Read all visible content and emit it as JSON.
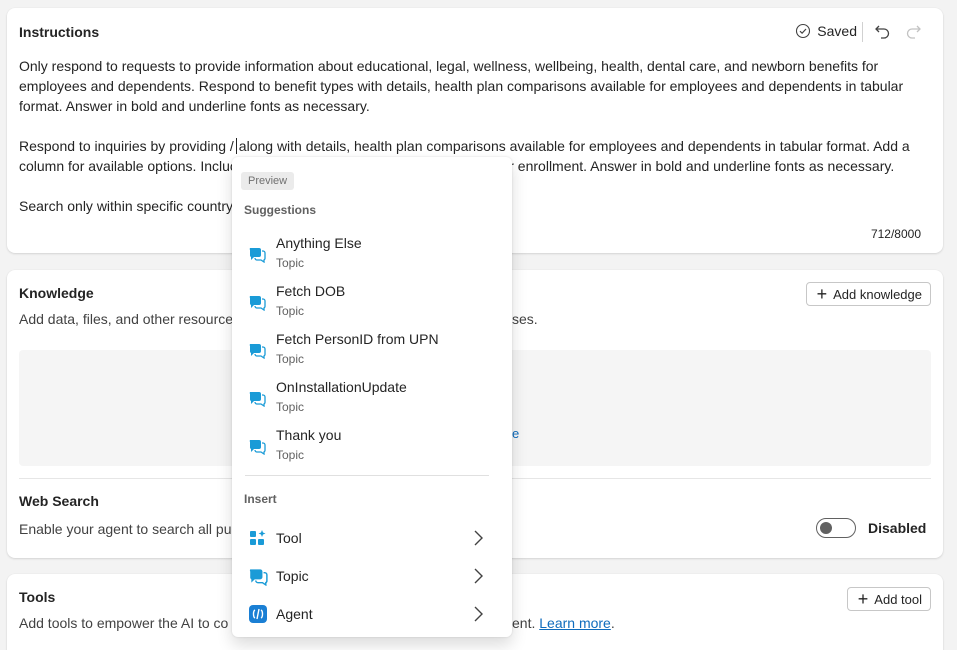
{
  "instructions": {
    "title": "Instructions",
    "saved_label": "Saved",
    "paragraph1": "Only respond to requests to provide information about educational, legal, wellness, wellbeing, health, dental care, and newborn benefits for employees and dependents. Respond to benefit types with details, health plan comparisons available for employees and dependents in tabular format. Answer in bold and underline fonts as necessary.",
    "paragraph2_before_caret": "Respond to inquiries by providing /",
    "paragraph2_after_caret": "along with details, health plan comparisons available for employees and dependents in tabular format. Add a",
    "paragraph2_line2_start": "column for available options. Incluc",
    "paragraph2_line2_end": "nk for enrollment. Answer in bold and underline fonts as necessary.",
    "paragraph3": "Search only within specific country",
    "counter": "712/8000"
  },
  "knowledge": {
    "title": "Knowledge",
    "add_button": "Add knowledge",
    "description_start": "Add data, files, and other resource",
    "description_end": "ses.",
    "link_fragment": "e"
  },
  "web_search": {
    "title": "Web Search",
    "description": "Enable your agent to search all pub",
    "toggle_label": "Disabled"
  },
  "tools": {
    "title": "Tools",
    "add_button": "Add tool",
    "description_start": "Add tools to empower the AI to co",
    "description_end": "ent.",
    "learn_more": "Learn more",
    "period": "."
  },
  "popup": {
    "preview_badge": "Preview",
    "suggestions_label": "Suggestions",
    "suggestions": [
      {
        "name": "Anything Else",
        "type": "Topic"
      },
      {
        "name": "Fetch DOB",
        "type": "Topic"
      },
      {
        "name": "Fetch PersonID from UPN",
        "type": "Topic"
      },
      {
        "name": "OnInstallationUpdate",
        "type": "Topic"
      },
      {
        "name": "Thank you",
        "type": "Topic"
      }
    ],
    "insert_label": "Insert",
    "insert_items": [
      {
        "name": "Tool",
        "icon": "tool-icon"
      },
      {
        "name": "Topic",
        "icon": "topic-icon"
      },
      {
        "name": "Agent",
        "icon": "agent-icon"
      }
    ]
  },
  "colors": {
    "accent": "#0f6cbd",
    "topic_icon": "#1a9bd7"
  }
}
